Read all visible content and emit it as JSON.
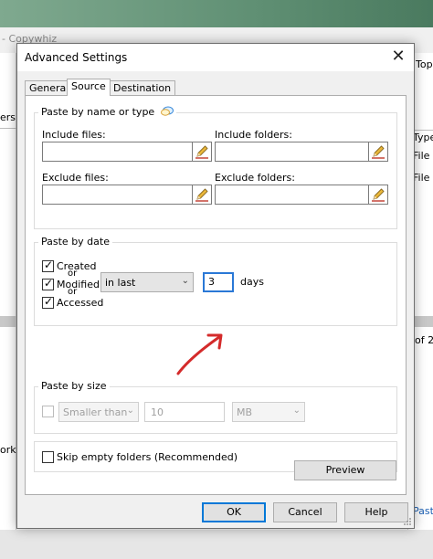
{
  "background": {
    "window_title_fragment": "- Copywhiz",
    "right_fragments": [
      "Top",
      "Type",
      "File f",
      "File f",
      "of 2",
      "Past"
    ],
    "left_fragments": [
      "ers.",
      "orks"
    ]
  },
  "dialog": {
    "title": "Advanced Settings",
    "close_glyph": "✕",
    "tabs": [
      {
        "label": "General",
        "active": false
      },
      {
        "label": "Source",
        "active": true
      },
      {
        "label": "Destination",
        "active": false
      }
    ],
    "paste_by_name": {
      "title": "Paste by name or type",
      "include_files_label": "Include files:",
      "include_folders_label": "Include folders:",
      "exclude_files_label": "Exclude files:",
      "exclude_folders_label": "Exclude folders:",
      "include_files_value": "",
      "include_folders_value": "",
      "exclude_files_value": "",
      "exclude_folders_value": ""
    },
    "paste_by_date": {
      "title": "Paste by date",
      "created_label": "Created",
      "or_1": "or",
      "modified_label": "Modified",
      "or_2": "or",
      "accessed_label": "Accessed",
      "created_checked": true,
      "modified_checked": true,
      "accessed_checked": true,
      "period_option": "in last",
      "days_value": "3",
      "days_label": "days"
    },
    "paste_by_size": {
      "title": "Paste by size",
      "enabled": false,
      "comparison_option": "Smaller than",
      "size_value": "10",
      "unit_option": "MB"
    },
    "skip_empty_folders_label": "Skip empty folders (Recommended)",
    "skip_empty_folders_checked": false,
    "preview_label": "Preview",
    "ok_label": "OK",
    "cancel_label": "Cancel",
    "help_label": "Help"
  },
  "colors": {
    "focus_blue": "#2a78d6",
    "annotation_arrow": "#d42b2b",
    "pencil_yellow": "#e8b63a"
  },
  "icons": [
    "close-icon",
    "tooltip-bubble-icon",
    "pencil-icon",
    "checkmark-icon",
    "chevron-down-icon",
    "annotation-arrow-icon",
    "resize-grip-icon"
  ]
}
